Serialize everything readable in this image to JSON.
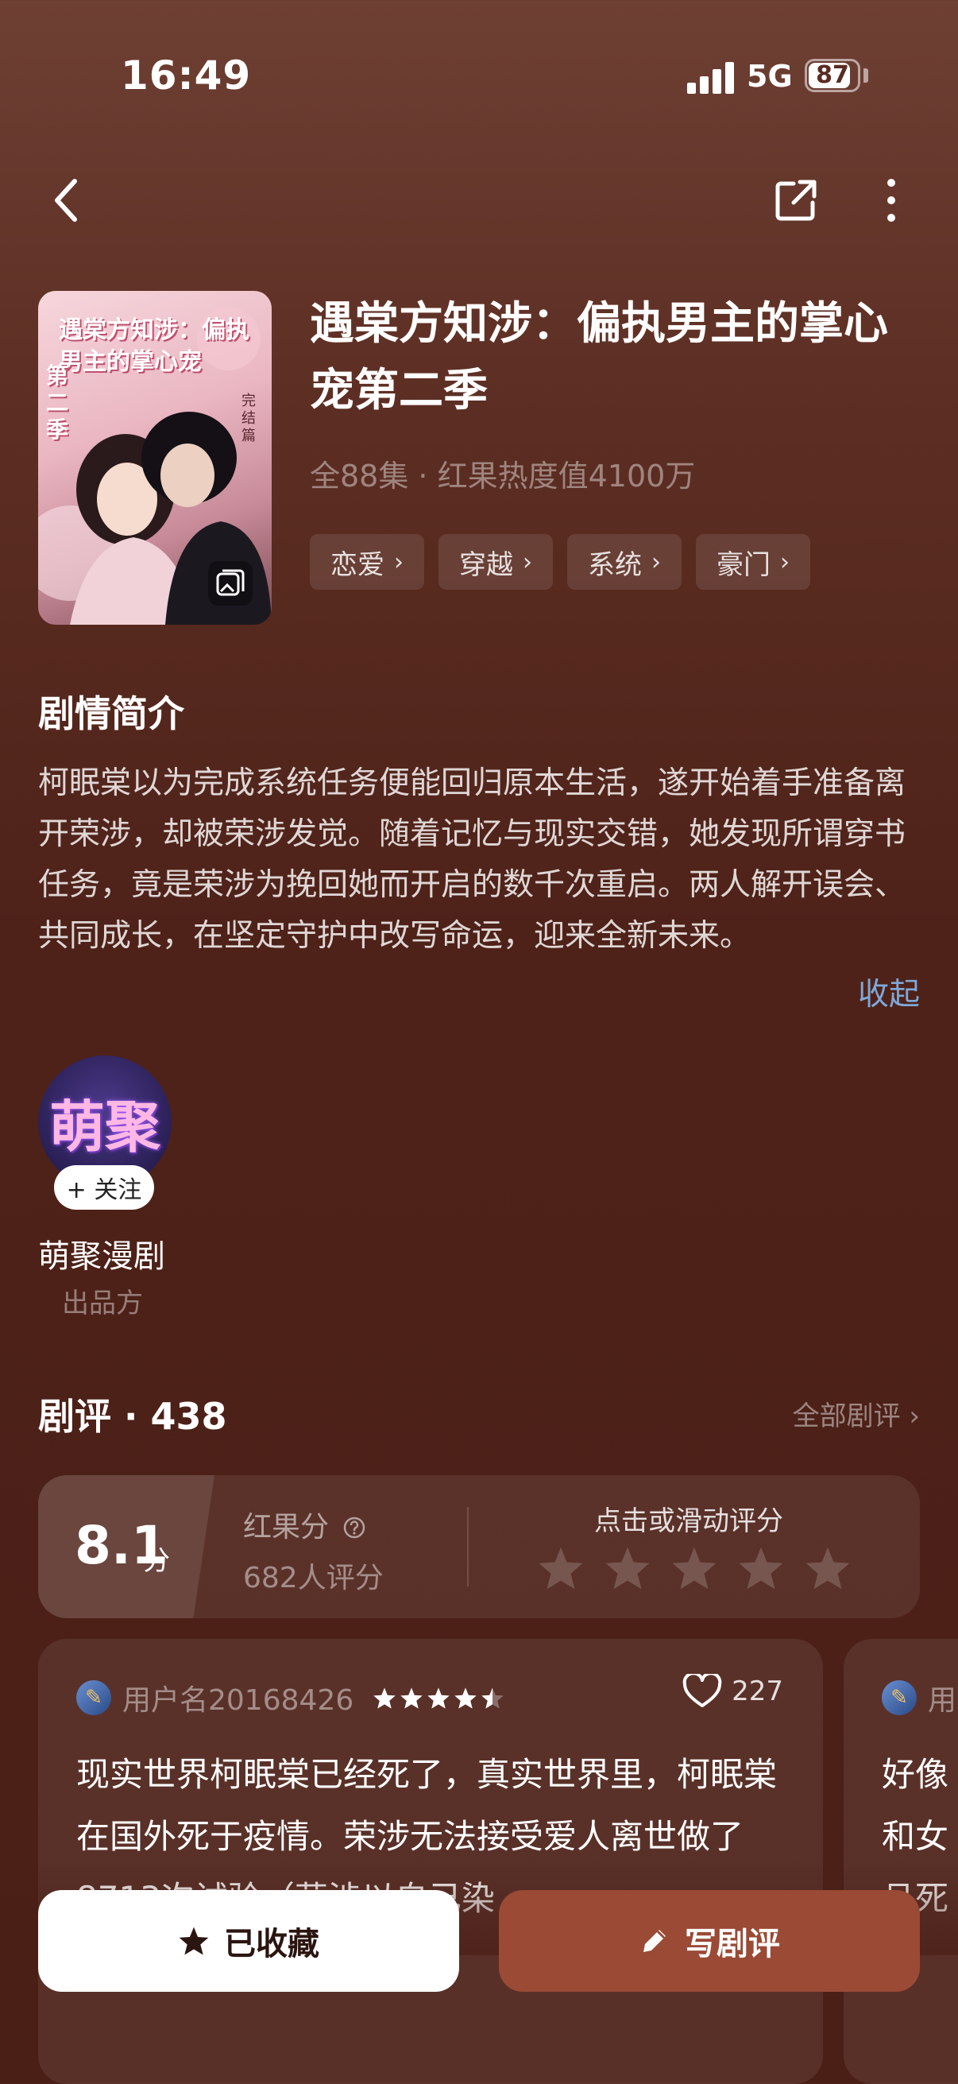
{
  "status_bar": {
    "time": "16:49",
    "network": "5G",
    "battery": "87",
    "battery_level": 0.87
  },
  "drama": {
    "title": "遇棠方知涉：偏执男主的掌心宠第二季",
    "meta": "全88集 · 红果热度值4100万",
    "tags": [
      "恋爱",
      "穿越",
      "系统",
      "豪门"
    ],
    "poster_title": "遇棠方知涉：偏执男主的掌心宠",
    "poster_season": "第二季",
    "poster_badge": "完结篇"
  },
  "synopsis": {
    "heading": "剧情简介",
    "text": "柯眠棠以为完成系统任务便能回归原本生活，遂开始着手准备离开荣涉，却被荣涉发觉。随着记忆与现实交错，她发现所谓穿书任务，竟是荣涉为挽回她而开启的数千次重启。两人解开误会、共同成长，在坚定守护中改写命运，迎来全新未来。",
    "collapse_label": "收起"
  },
  "producer": {
    "logo_text": "萌聚",
    "follow_label": "+ 关注",
    "name": "萌聚漫剧",
    "role": "出品方"
  },
  "reviews": {
    "title": "剧评 · 438",
    "all_label": "全部剧评 ›",
    "score": "8.1",
    "score_unit": "分",
    "score_label": "红果分",
    "rater_count": "682人评分",
    "rate_hint": "点击或滑动评分",
    "items": [
      {
        "username": "用户名20168426",
        "rating": 4.5,
        "likes": "227",
        "text": "现实世界柯眠棠已经死了，真实世界里，柯眠棠在国外死于疫情。荣涉无法接受爱人离世做了8713次试验（荣涉以自己染"
      },
      {
        "username": "用",
        "text": "好像和女且死"
      }
    ]
  },
  "actions": {
    "collected_label": "已收藏",
    "write_label": "写剧评"
  },
  "colors": {
    "accent": "#9a4a35",
    "link": "#7fa8d8",
    "background": "#4e2219"
  },
  "icons": [
    "back-icon",
    "share-icon",
    "more-icon",
    "star-icon",
    "heart-icon",
    "pencil-icon",
    "question-icon"
  ]
}
